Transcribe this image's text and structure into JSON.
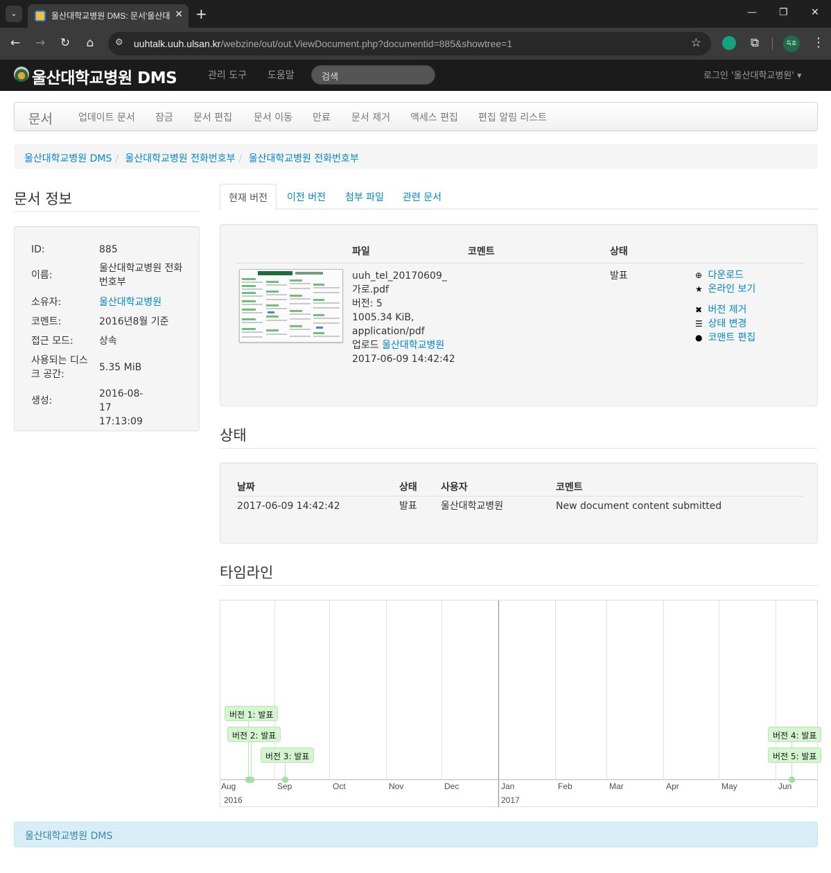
{
  "browser": {
    "tab_title": "울산대학교병원 DMS: 문서'울산대학교병원 전화번호부'",
    "url_host": "uuhtalk.uuh.ulsan.kr",
    "url_path": "/webzine/out/out.ViewDocument.php?documentid=885&showtree=1",
    "profile_label": "득호"
  },
  "navbar": {
    "brand": "울산대학교병원 DMS",
    "links": [
      "관리 도구",
      "도움말"
    ],
    "search_placeholder": "검색",
    "login": "로그인 '울산대학교병원'"
  },
  "actionbar": {
    "title": "문서",
    "actions": [
      "업데이트 문서",
      "잠금",
      "문서 편집",
      "문서 이동",
      "만료",
      "문서 제거",
      "액세스 편집",
      "편집 알림 리스트"
    ]
  },
  "breadcrumb": [
    "울산대학교병원 DMS",
    "울산대학교병원 전화번호부",
    "울산대학교병원 전화번호부"
  ],
  "doc_info": {
    "title": "문서 정보",
    "id_label": "ID:",
    "id_value": "885",
    "name_label": "이름:",
    "name_value": "울산대학교병원 전화번호부",
    "owner_label": "소유자:",
    "owner_value": "울산대학교병원",
    "comment_label": "코멘트:",
    "comment_value": "2016년8월 기준",
    "access_label": "접근 모드:",
    "access_value": "상속",
    "disk_label": "사용되는 디스크 공간:",
    "disk_value": "5.35 MiB",
    "created_label": "생성:",
    "created_value": "2016-08-17 17:13:09"
  },
  "tabs": [
    "현재 버전",
    "이전 버전",
    "첨부 파일",
    "관련 문서"
  ],
  "current_version": {
    "headers": {
      "file": "파일",
      "comment": "코멘트",
      "status": "상태"
    },
    "filename": "uuh_tel_20170609_가로.pdf",
    "version": "버전: 5",
    "size_type": "1005.34 KiB, application/pdf",
    "uploaded_by_label": "업로드",
    "uploaded_by": "울산대학교병원",
    "uploaded_at": "2017-06-09 14:42:42",
    "status": "발표",
    "actions": [
      "다운로드",
      "온라인 보기",
      "버전 제거",
      "상태 변경",
      "코맨트 편집"
    ]
  },
  "status_section": {
    "title": "상태",
    "headers": {
      "date": "날짜",
      "status": "상태",
      "user": "사용자",
      "comment": "코멘트"
    },
    "rows": [
      {
        "date": "2017-06-09 14:42:42",
        "status": "발표",
        "user": "울산대학교병원",
        "comment": "New document content submitted"
      }
    ]
  },
  "timeline": {
    "title": "타임라인",
    "months": [
      "Aug",
      "Sep",
      "Oct",
      "Nov",
      "Dec",
      "Jan",
      "Feb",
      "Mar",
      "Apr",
      "May",
      "Jun"
    ],
    "years": [
      "2016",
      "2017"
    ],
    "items": [
      "버전 1: 발표",
      "버전 2: 발표",
      "버전 3: 발표",
      "버전 4: 발표",
      "버전 5: 발표"
    ]
  },
  "footer": {
    "text": "울산대학교병원 DMS"
  },
  "colors": {
    "link": "#0088cc",
    "timeline_item": "#d5f5d1",
    "navbar": "#1b1b1b",
    "footer_bg": "#d9edf7"
  }
}
